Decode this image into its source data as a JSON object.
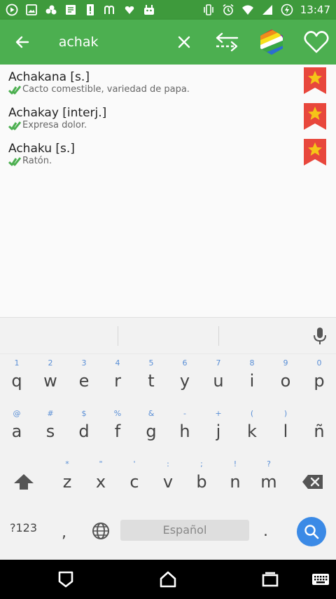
{
  "status_bar": {
    "time": "13:47"
  },
  "search": {
    "query": "achak"
  },
  "results": [
    {
      "term": "Achakana [s.]",
      "definition": "Cacto comestible, variedad de papa."
    },
    {
      "term": "Achakay [interj.]",
      "definition": "Expresa dolor."
    },
    {
      "term": "Achaku [s.]",
      "definition": "Ratón."
    }
  ],
  "keyboard": {
    "row1": [
      {
        "key": "q",
        "hint": "1"
      },
      {
        "key": "w",
        "hint": "2"
      },
      {
        "key": "e",
        "hint": "3"
      },
      {
        "key": "r",
        "hint": "4"
      },
      {
        "key": "t",
        "hint": "5"
      },
      {
        "key": "y",
        "hint": "6"
      },
      {
        "key": "u",
        "hint": "7"
      },
      {
        "key": "i",
        "hint": "8"
      },
      {
        "key": "o",
        "hint": "9"
      },
      {
        "key": "p",
        "hint": "0"
      }
    ],
    "row2": [
      {
        "key": "a",
        "hint": "@"
      },
      {
        "key": "s",
        "hint": "#"
      },
      {
        "key": "d",
        "hint": "$"
      },
      {
        "key": "f",
        "hint": "%"
      },
      {
        "key": "g",
        "hint": "&"
      },
      {
        "key": "h",
        "hint": "-"
      },
      {
        "key": "j",
        "hint": "+"
      },
      {
        "key": "k",
        "hint": "("
      },
      {
        "key": "l",
        "hint": ")"
      },
      {
        "key": "ñ",
        "hint": ""
      }
    ],
    "row3": [
      {
        "key": "z",
        "hint": "*"
      },
      {
        "key": "x",
        "hint": "\""
      },
      {
        "key": "c",
        "hint": "'"
      },
      {
        "key": "v",
        "hint": ":"
      },
      {
        "key": "b",
        "hint": ";"
      },
      {
        "key": "n",
        "hint": "!"
      },
      {
        "key": "m",
        "hint": "?"
      }
    ],
    "mode_label": "?123",
    "comma_label": ",",
    "period_label": ".",
    "space_label": "Español"
  },
  "colors": {
    "status_bar": "#3e9a3c",
    "app_bar": "#4caf50",
    "bookmark": "#e8473c",
    "star": "#f5c518",
    "check": "#4caf50",
    "search_key": "#3b8ae6",
    "key_hint": "#5a8fd6"
  },
  "icons": {
    "back": "arrow-left-icon",
    "clear": "close-icon",
    "swap": "swap-arrows-icon",
    "flag": "wiphala-flag-icon",
    "favorite": "heart-outline-icon",
    "bookmark": "star-bookmark-icon",
    "verified": "double-check-icon"
  }
}
